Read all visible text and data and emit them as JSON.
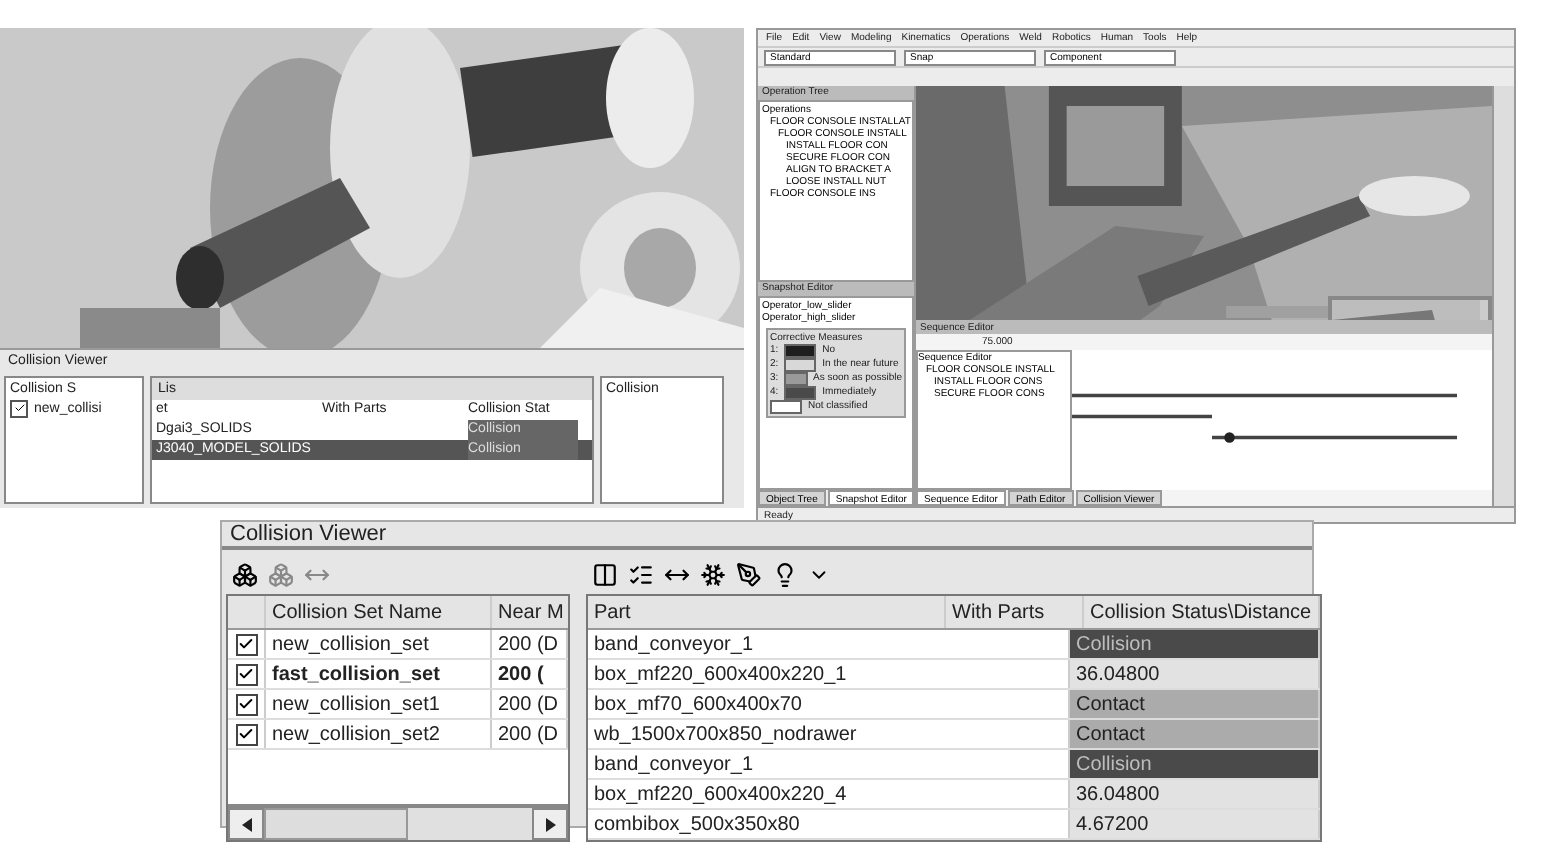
{
  "small_viewer": {
    "title": "Collision Viewer",
    "sets_header": "Collision S",
    "sets": [
      {
        "name": "new_collisi",
        "checked": true
      }
    ],
    "toolbar_text": "Lis",
    "columns": [
      "et",
      "With Parts",
      "Collision Stat"
    ],
    "rows": [
      {
        "part": "Dgai3_SOLIDS",
        "status": "Collision",
        "selected": false
      },
      {
        "part": "J3040_MODEL_SOLIDS",
        "status": "Collision",
        "selected": true
      }
    ],
    "side_column": "Collision"
  },
  "app": {
    "menu": [
      "File",
      "Edit",
      "View",
      "Modeling",
      "Kinematics",
      "Operations",
      "Weld",
      "Robotics",
      "Human",
      "Tools",
      "Help"
    ],
    "toolbar_fields": [
      "Standard",
      "Snap",
      "Component"
    ],
    "operation_tree": {
      "title": "Operation Tree",
      "items": [
        {
          "label": "Operations",
          "children": [
            {
              "label": "FLOOR CONSOLE INSTALLAT",
              "children": [
                {
                  "label": "FLOOR CONSOLE INSTALL",
                  "children": [
                    {
                      "label": "INSTALL FLOOR CON"
                    },
                    {
                      "label": "SECURE FLOOR CON"
                    },
                    {
                      "label": "ALIGN TO BRACKET A"
                    },
                    {
                      "label": "LOOSE INSTALL NUT"
                    }
                  ]
                }
              ]
            },
            {
              "label": "FLOOR CONSOLE INS"
            }
          ]
        }
      ]
    },
    "snapshot_editor": {
      "title": "Snapshot Editor",
      "items": [
        "Operator_low_slider",
        "Operator_high_slider"
      ],
      "legend_title": "Corrective Measures",
      "legend": [
        {
          "number": "1:",
          "label": "No",
          "color": "#1e1e1e"
        },
        {
          "number": "2:",
          "label": "In the near future",
          "color": "#d8d8d8"
        },
        {
          "number": "3:",
          "label": "As soon as possible",
          "color": "#9a9a9a"
        },
        {
          "number": "4:",
          "label": "Immediately",
          "color": "#4a4a4a"
        },
        {
          "label": "Not classified",
          "color": "#ffffff"
        }
      ]
    },
    "left_tabs": [
      {
        "label": "Object Tree",
        "selected": false
      },
      {
        "label": "Snapshot Editor",
        "selected": true
      }
    ],
    "sequence_editor": {
      "title": "Sequence Editor",
      "time": "75.000",
      "column": "Sequence Editor",
      "items": [
        {
          "label": "FLOOR CONSOLE INSTALL"
        },
        {
          "label": "INSTALL FLOOR CONS"
        },
        {
          "label": "SECURE FLOOR CONS"
        }
      ]
    },
    "bottom_tabs": [
      {
        "label": "Sequence Editor",
        "selected": true
      },
      {
        "label": "Path Editor",
        "selected": false
      },
      {
        "label": "Collision Viewer",
        "selected": false
      }
    ],
    "status": "Ready"
  },
  "collision_viewer": {
    "title": "Collision Viewer",
    "sets_columns": [
      "Collision Set Name",
      "Near M"
    ],
    "sets": [
      {
        "name": "new_collision_set",
        "near": "200 (D",
        "checked": true,
        "active": false
      },
      {
        "name": "fast_collision_set",
        "near": "200 (",
        "checked": true,
        "active": true
      },
      {
        "name": "new_collision_set1",
        "near": "200 (D",
        "checked": true,
        "active": false
      },
      {
        "name": "new_collision_set2",
        "near": "200 (D",
        "checked": true,
        "active": false
      }
    ],
    "columns": [
      "Part",
      "With Parts",
      "Collision Status\\Distance"
    ],
    "rows": [
      {
        "part": "band_conveyor_1",
        "value": "Collision",
        "kind": "collision"
      },
      {
        "part": "box_mf220_600x400x220_1",
        "value": "36.04800",
        "kind": "distance"
      },
      {
        "part": "box_mf70_600x400x70",
        "value": "Contact",
        "kind": "contact"
      },
      {
        "part": "wb_1500x700x850_nodrawer",
        "value": "Contact",
        "kind": "contact"
      },
      {
        "part": "band_conveyor_1",
        "value": "Collision",
        "kind": "collision"
      },
      {
        "part": "box_mf220_600x400x220_4",
        "value": "36.04800",
        "kind": "distance"
      },
      {
        "part": "combibox_500x350x80",
        "value": "4.67200",
        "kind": "distance"
      }
    ]
  }
}
